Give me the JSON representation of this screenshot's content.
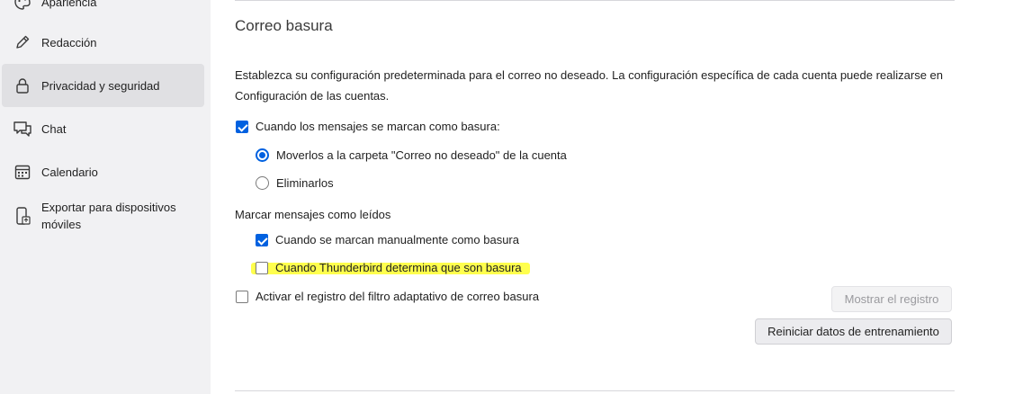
{
  "sidebar": {
    "items": [
      {
        "label": "Apariencia",
        "icon": "palette-icon"
      },
      {
        "label": "Redacción",
        "icon": "pencil-icon"
      },
      {
        "label": "Privacidad y seguridad",
        "icon": "lock-icon",
        "selected": true
      },
      {
        "label": "Chat",
        "icon": "chat-icon"
      },
      {
        "label": "Calendario",
        "icon": "calendar-icon"
      },
      {
        "label_line1": "Exportar para dispositivos",
        "label_line2": "móviles",
        "icon": "mobile-export-icon"
      }
    ]
  },
  "junk": {
    "title": "Correo basura",
    "description": "Establezca su configuración predeterminada para el correo no deseado. La configuración específica de cada cuenta puede realizarse en Configuración de las cuentas.",
    "mark_as_junk": {
      "label": "Cuando los mensajes se marcan como basura:",
      "checked": true
    },
    "move_option": {
      "label": "Moverlos a la carpeta \"Correo no deseado\" de la cuenta",
      "selected": true
    },
    "delete_option": {
      "label": "Eliminarlos",
      "selected": false
    },
    "mark_read_heading": "Marcar mensajes como leídos",
    "manual_mark": {
      "label": "Cuando se marcan manualmente como basura",
      "checked": true
    },
    "auto_mark": {
      "label": "Cuando Thunderbird determina que son basura",
      "checked": false
    },
    "adaptive_log": {
      "label": "Activar el registro del filtro adaptativo de correo basura",
      "checked": false
    },
    "show_log_button": "Mostrar el registro",
    "reset_training_button": "Reiniciar datos de entrenamiento"
  },
  "colors": {
    "accent": "#0061e0",
    "highlight": "#ffff3a",
    "sidebar_bg": "#f1f1f3"
  }
}
